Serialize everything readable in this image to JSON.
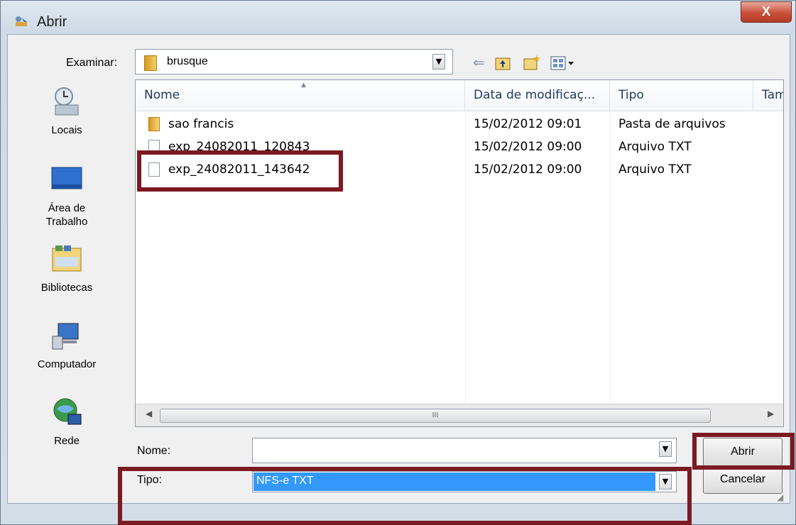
{
  "window": {
    "title": "Abrir",
    "close_glyph": "X"
  },
  "lookin": {
    "label": "Examinar:",
    "value": "brusque"
  },
  "toolbar": {
    "back_icon": "back-arrow-icon",
    "up_icon": "up-folder-icon",
    "new_icon": "new-folder-icon",
    "view_icon": "view-menu-icon"
  },
  "places": [
    {
      "label": "Locais",
      "icon": "recent-places-icon"
    },
    {
      "label": "Área de Trabalho",
      "icon": "desktop-icon"
    },
    {
      "label": "Bibliotecas",
      "icon": "libraries-icon"
    },
    {
      "label": "Computador",
      "icon": "computer-icon"
    },
    {
      "label": "Rede",
      "icon": "network-icon"
    }
  ],
  "columns": {
    "name": "Nome",
    "date": "Data de modificaç...",
    "type": "Tipo",
    "size": "Tam"
  },
  "files": [
    {
      "name": "sao francis",
      "date": "15/02/2012 09:01",
      "type": "Pasta de arquivos",
      "icon": "folder-icon"
    },
    {
      "name": "exp_24082011_120843",
      "date": "15/02/2012 09:00",
      "type": "Arquivo TXT",
      "icon": "text-file-icon"
    },
    {
      "name": "exp_24082011_143642",
      "date": "15/02/2012 09:00",
      "type": "Arquivo TXT",
      "icon": "text-file-icon"
    }
  ],
  "scrollbar": {
    "thumb_grip": "III"
  },
  "fields": {
    "name_label": "Nome:",
    "name_value": "",
    "type_label": "Tipo:",
    "type_value": "NFS-e TXT"
  },
  "buttons": {
    "open": "Abrir",
    "cancel": "Cancelar"
  },
  "colors": {
    "highlight": "#7b1a22",
    "selection": "#3399ff"
  }
}
